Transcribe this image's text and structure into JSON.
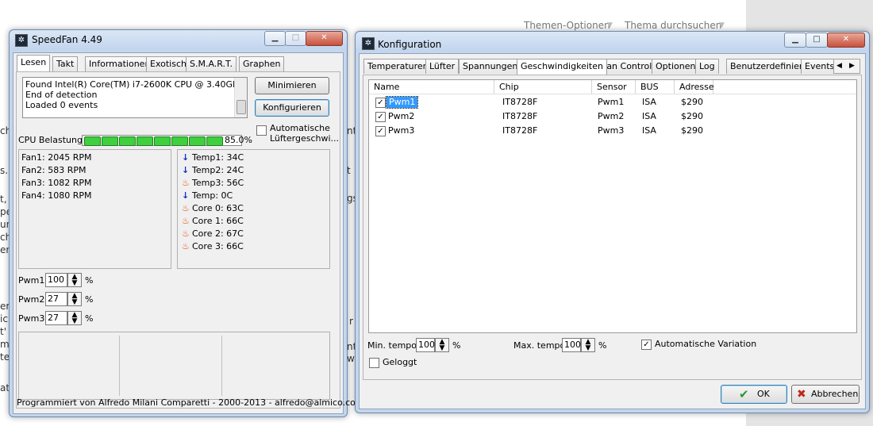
{
  "background": {
    "nav_links": [
      "Themen-Optionen",
      "Thema durchsuchen"
    ]
  },
  "speedfan": {
    "title": "SpeedFan 4.49",
    "tabs": [
      "Lesen",
      "Takt",
      "Informationen",
      "Exotisch",
      "S.M.A.R.T.",
      "Graphen"
    ],
    "log_lines": [
      "Found Intel(R) Core(TM) i7-2600K CPU @ 3.40GHz",
      "End of detection",
      "Loaded 0 events"
    ],
    "minimize_label": "Minimieren",
    "configure_label": "Konfigurieren",
    "auto_fan_label_1": "Automatische",
    "auto_fan_label_2": "Lüftergeschwi...",
    "cpu_label": "CPU Belastung",
    "cpu_value": "85.0%",
    "cpu_load_fraction": 0.85,
    "fans": [
      "Fan1: 2045 RPM",
      "Fan2: 583 RPM",
      "Fan3: 1082 RPM",
      "Fan4: 1080 RPM"
    ],
    "temps": [
      {
        "label": "Temp1: 34C",
        "icon": "down"
      },
      {
        "label": "Temp2: 24C",
        "icon": "down"
      },
      {
        "label": "Temp3: 56C",
        "icon": "flame"
      },
      {
        "label": "Temp:  0C",
        "icon": "down"
      },
      {
        "label": "Core 0: 63C",
        "icon": "flame"
      },
      {
        "label": "Core 1: 66C",
        "icon": "flame"
      },
      {
        "label": "Core 2: 67C",
        "icon": "flame"
      },
      {
        "label": "Core 3: 66C",
        "icon": "flame"
      }
    ],
    "pwm": [
      {
        "label": "Pwm1:",
        "value": "100",
        "unit": "%"
      },
      {
        "label": "Pwm2:",
        "value": "27",
        "unit": "%"
      },
      {
        "label": "Pwm3:",
        "value": "27",
        "unit": "%"
      }
    ],
    "footer": "Programmiert von Alfredo Milani Comparetti - 2000-2013 - alfredo@almico.com"
  },
  "config": {
    "title": "Konfiguration",
    "tabs": [
      "Temperaturen",
      "Lüfter",
      "Spannungen",
      "Geschwindigkeiten",
      "Fan Control",
      "Optionen",
      "Log",
      "Benutzerdefiniert",
      "Events"
    ],
    "columns": [
      "Name",
      "Chip",
      "Sensor",
      "BUS",
      "Adresse"
    ],
    "rows": [
      {
        "name": "Pwm1",
        "chip": "IT8728F",
        "sensor": "Pwm1",
        "bus": "ISA",
        "addr": "$290"
      },
      {
        "name": "Pwm2",
        "chip": "IT8728F",
        "sensor": "Pwm2",
        "bus": "ISA",
        "addr": "$290"
      },
      {
        "name": "Pwm3",
        "chip": "IT8728F",
        "sensor": "Pwm3",
        "bus": "ISA",
        "addr": "$290"
      }
    ],
    "min_label": "Min. tempo",
    "min_value": "100",
    "max_label": "Max. tempo",
    "max_value": "100",
    "percent": "%",
    "auto_var_label": "Automatische Variation",
    "logged_label": "Geloggt",
    "ok_label": "OK",
    "cancel_label": "Abbrechen"
  }
}
